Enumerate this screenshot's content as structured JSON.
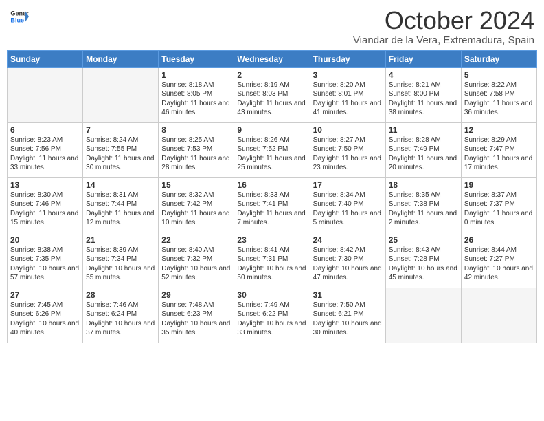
{
  "header": {
    "logo_line1": "General",
    "logo_line2": "Blue",
    "title": "October 2024",
    "subtitle": "Viandar de la Vera, Extremadura, Spain"
  },
  "weekdays": [
    "Sunday",
    "Monday",
    "Tuesday",
    "Wednesday",
    "Thursday",
    "Friday",
    "Saturday"
  ],
  "weeks": [
    [
      {
        "day": "",
        "empty": true
      },
      {
        "day": "",
        "empty": true
      },
      {
        "day": "1",
        "sunrise": "8:18 AM",
        "sunset": "8:05 PM",
        "daylight": "11 hours and 46 minutes."
      },
      {
        "day": "2",
        "sunrise": "8:19 AM",
        "sunset": "8:03 PM",
        "daylight": "11 hours and 43 minutes."
      },
      {
        "day": "3",
        "sunrise": "8:20 AM",
        "sunset": "8:01 PM",
        "daylight": "11 hours and 41 minutes."
      },
      {
        "day": "4",
        "sunrise": "8:21 AM",
        "sunset": "8:00 PM",
        "daylight": "11 hours and 38 minutes."
      },
      {
        "day": "5",
        "sunrise": "8:22 AM",
        "sunset": "7:58 PM",
        "daylight": "11 hours and 36 minutes."
      }
    ],
    [
      {
        "day": "6",
        "sunrise": "8:23 AM",
        "sunset": "7:56 PM",
        "daylight": "11 hours and 33 minutes."
      },
      {
        "day": "7",
        "sunrise": "8:24 AM",
        "sunset": "7:55 PM",
        "daylight": "11 hours and 30 minutes."
      },
      {
        "day": "8",
        "sunrise": "8:25 AM",
        "sunset": "7:53 PM",
        "daylight": "11 hours and 28 minutes."
      },
      {
        "day": "9",
        "sunrise": "8:26 AM",
        "sunset": "7:52 PM",
        "daylight": "11 hours and 25 minutes."
      },
      {
        "day": "10",
        "sunrise": "8:27 AM",
        "sunset": "7:50 PM",
        "daylight": "11 hours and 23 minutes."
      },
      {
        "day": "11",
        "sunrise": "8:28 AM",
        "sunset": "7:49 PM",
        "daylight": "11 hours and 20 minutes."
      },
      {
        "day": "12",
        "sunrise": "8:29 AM",
        "sunset": "7:47 PM",
        "daylight": "11 hours and 17 minutes."
      }
    ],
    [
      {
        "day": "13",
        "sunrise": "8:30 AM",
        "sunset": "7:46 PM",
        "daylight": "11 hours and 15 minutes."
      },
      {
        "day": "14",
        "sunrise": "8:31 AM",
        "sunset": "7:44 PM",
        "daylight": "11 hours and 12 minutes."
      },
      {
        "day": "15",
        "sunrise": "8:32 AM",
        "sunset": "7:42 PM",
        "daylight": "11 hours and 10 minutes."
      },
      {
        "day": "16",
        "sunrise": "8:33 AM",
        "sunset": "7:41 PM",
        "daylight": "11 hours and 7 minutes."
      },
      {
        "day": "17",
        "sunrise": "8:34 AM",
        "sunset": "7:40 PM",
        "daylight": "11 hours and 5 minutes."
      },
      {
        "day": "18",
        "sunrise": "8:35 AM",
        "sunset": "7:38 PM",
        "daylight": "11 hours and 2 minutes."
      },
      {
        "day": "19",
        "sunrise": "8:37 AM",
        "sunset": "7:37 PM",
        "daylight": "11 hours and 0 minutes."
      }
    ],
    [
      {
        "day": "20",
        "sunrise": "8:38 AM",
        "sunset": "7:35 PM",
        "daylight": "10 hours and 57 minutes."
      },
      {
        "day": "21",
        "sunrise": "8:39 AM",
        "sunset": "7:34 PM",
        "daylight": "10 hours and 55 minutes."
      },
      {
        "day": "22",
        "sunrise": "8:40 AM",
        "sunset": "7:32 PM",
        "daylight": "10 hours and 52 minutes."
      },
      {
        "day": "23",
        "sunrise": "8:41 AM",
        "sunset": "7:31 PM",
        "daylight": "10 hours and 50 minutes."
      },
      {
        "day": "24",
        "sunrise": "8:42 AM",
        "sunset": "7:30 PM",
        "daylight": "10 hours and 47 minutes."
      },
      {
        "day": "25",
        "sunrise": "8:43 AM",
        "sunset": "7:28 PM",
        "daylight": "10 hours and 45 minutes."
      },
      {
        "day": "26",
        "sunrise": "8:44 AM",
        "sunset": "7:27 PM",
        "daylight": "10 hours and 42 minutes."
      }
    ],
    [
      {
        "day": "27",
        "sunrise": "7:45 AM",
        "sunset": "6:26 PM",
        "daylight": "10 hours and 40 minutes."
      },
      {
        "day": "28",
        "sunrise": "7:46 AM",
        "sunset": "6:24 PM",
        "daylight": "10 hours and 37 minutes."
      },
      {
        "day": "29",
        "sunrise": "7:48 AM",
        "sunset": "6:23 PM",
        "daylight": "10 hours and 35 minutes."
      },
      {
        "day": "30",
        "sunrise": "7:49 AM",
        "sunset": "6:22 PM",
        "daylight": "10 hours and 33 minutes."
      },
      {
        "day": "31",
        "sunrise": "7:50 AM",
        "sunset": "6:21 PM",
        "daylight": "10 hours and 30 minutes."
      },
      {
        "day": "",
        "empty": true
      },
      {
        "day": "",
        "empty": true
      }
    ]
  ],
  "labels": {
    "sunrise": "Sunrise:",
    "sunset": "Sunset:",
    "daylight": "Daylight:"
  }
}
